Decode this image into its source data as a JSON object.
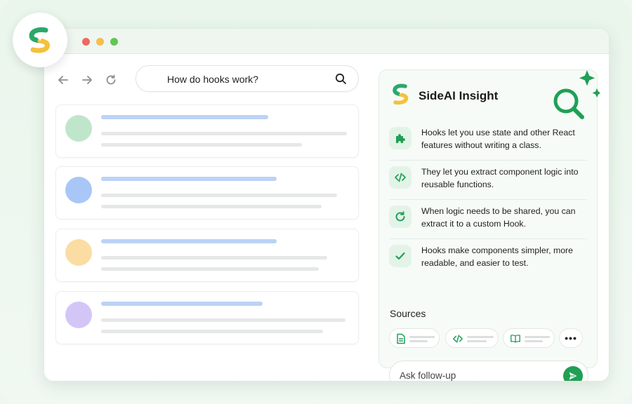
{
  "app": {
    "name": "SideAI Insight"
  },
  "browser": {
    "search_query": "How do hooks work?"
  },
  "icons": {
    "back": "arrow-left-icon",
    "forward": "arrow-right-icon",
    "reload": "reload-icon",
    "search": "search-icon"
  },
  "result_cards": [
    {
      "avatar_color": "#bfe6cb",
      "bar_color": "#bcd2f5"
    },
    {
      "avatar_color": "#a9c7f6",
      "bar_color": "#bcd2f5"
    },
    {
      "avatar_color": "#fbdda3",
      "bar_color": "#bcd2f5"
    },
    {
      "avatar_color": "#d3c6f7",
      "bar_color": "#bcd2f5"
    }
  ],
  "panel": {
    "title": "SideAI Insight",
    "insights": [
      {
        "icon": "puzzle-icon",
        "text": "Hooks let you use state and other React features without writing a class."
      },
      {
        "icon": "code-icon",
        "text": "They let you extract component logic into reusable functions."
      },
      {
        "icon": "refresh-icon",
        "text": "When logic needs to be shared, you can extract it to a custom Hook."
      },
      {
        "icon": "check-icon",
        "text": "Hooks make components simpler, more readable, and easier to test."
      }
    ],
    "sources_label": "Sources",
    "sources": [
      {
        "icon": "document-icon"
      },
      {
        "icon": "code-icon"
      },
      {
        "icon": "book-icon"
      }
    ],
    "more_label": "•••",
    "followup_placeholder": "Ask follow-up"
  },
  "colors": {
    "accent": "#1fa055",
    "brand_green": "#2ba86a",
    "brand_yellow": "#f4c13c"
  }
}
